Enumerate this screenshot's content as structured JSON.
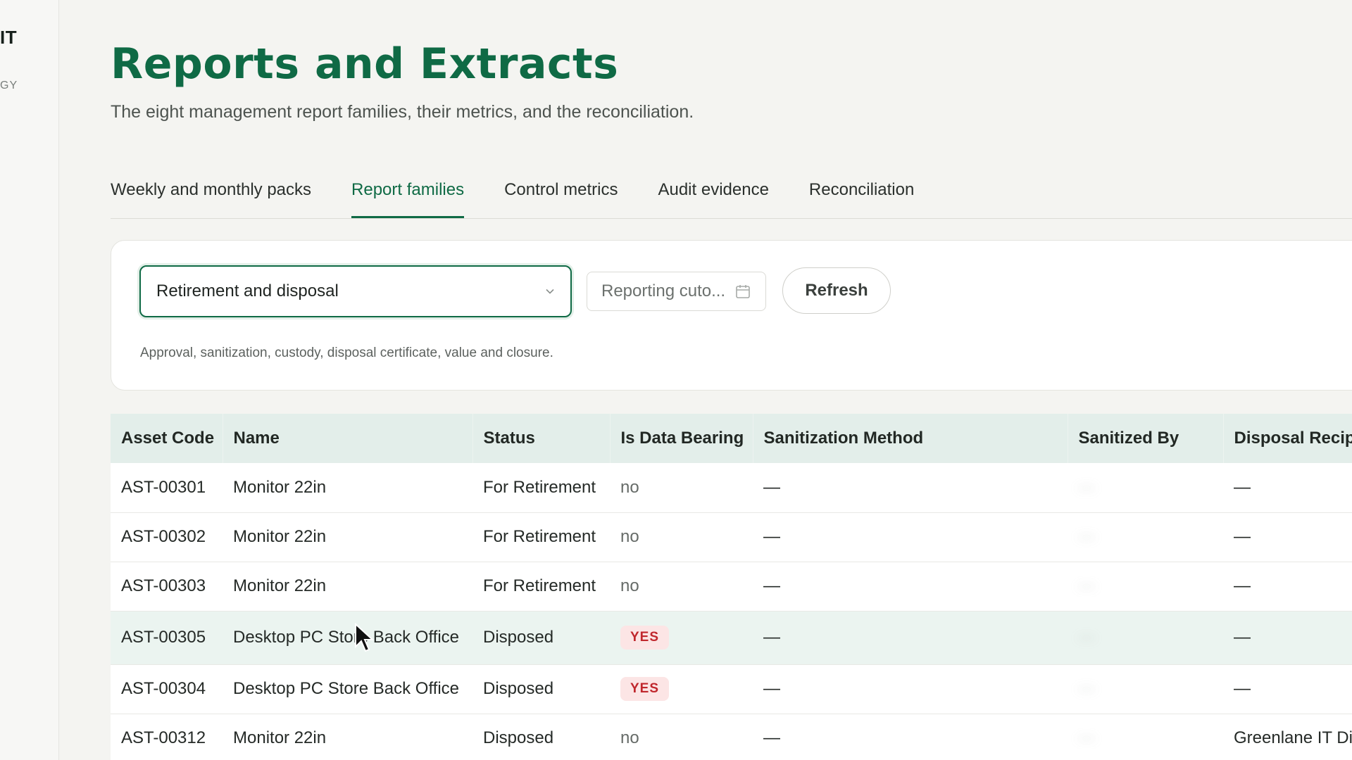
{
  "sidebar": {
    "brand_name": "IT",
    "brand_tagline": "GY"
  },
  "page": {
    "title": "Reports and Extracts",
    "subtitle": "The eight management report families, their metrics, and the reconciliation."
  },
  "tabs": [
    {
      "label": "Weekly and monthly packs",
      "active": false
    },
    {
      "label": "Report families",
      "active": true
    },
    {
      "label": "Control metrics",
      "active": false
    },
    {
      "label": "Audit evidence",
      "active": false
    },
    {
      "label": "Reconciliation",
      "active": false
    }
  ],
  "filters": {
    "report_family": {
      "value": "Retirement and disposal"
    },
    "cutoff": {
      "placeholder": "Reporting cuto..."
    },
    "refresh_label": "Refresh",
    "description": "Approval, sanitization, custody, disposal certificate, value and closure."
  },
  "table": {
    "columns": [
      "Asset Code",
      "Name",
      "Status",
      "Is Data Bearing",
      "Sanitization Method",
      "Sanitized By",
      "Disposal Recip"
    ],
    "rows": [
      {
        "asset_code": "AST-00301",
        "name": "Monitor 22in",
        "status": "For Retirement",
        "is_data_bearing": "no",
        "sanitization_method": "—",
        "sanitized_by": "—",
        "disposal_recipient": "—"
      },
      {
        "asset_code": "AST-00302",
        "name": "Monitor 22in",
        "status": "For Retirement",
        "is_data_bearing": "no",
        "sanitization_method": "—",
        "sanitized_by": "—",
        "disposal_recipient": "—"
      },
      {
        "asset_code": "AST-00303",
        "name": "Monitor 22in",
        "status": "For Retirement",
        "is_data_bearing": "no",
        "sanitization_method": "—",
        "sanitized_by": "—",
        "disposal_recipient": "—"
      },
      {
        "asset_code": "AST-00305",
        "name": "Desktop PC Store Back Office",
        "status": "Disposed",
        "is_data_bearing": "YES",
        "sanitization_method": "—",
        "sanitized_by": "—",
        "disposal_recipient": "—"
      },
      {
        "asset_code": "AST-00304",
        "name": "Desktop PC Store Back Office",
        "status": "Disposed",
        "is_data_bearing": "YES",
        "sanitization_method": "—",
        "sanitized_by": "—",
        "disposal_recipient": "—"
      },
      {
        "asset_code": "AST-00312",
        "name": "Monitor 22in",
        "status": "Disposed",
        "is_data_bearing": "no",
        "sanitization_method": "—",
        "sanitized_by": "—",
        "disposal_recipient": "Greenlane IT Di"
      }
    ]
  },
  "colors": {
    "brand_green": "#0f6a45",
    "header_bg": "#e3eeea",
    "badge_red": "#c0272d",
    "badge_bg": "#fce5e5"
  }
}
